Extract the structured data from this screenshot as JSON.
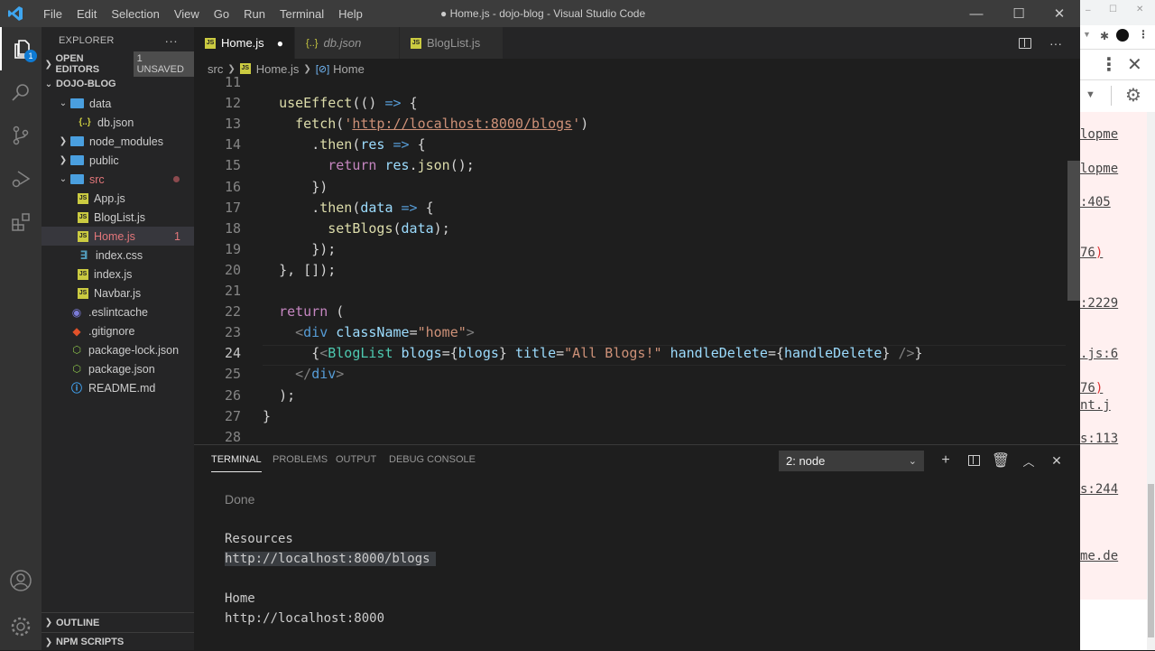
{
  "window": {
    "title": "● Home.js - dojo-blog - Visual Studio Code",
    "menu": [
      "File",
      "Edit",
      "Selection",
      "View",
      "Go",
      "Run",
      "Terminal",
      "Help"
    ],
    "controls": {
      "minimize": "—",
      "maximize": "☐",
      "close": "✕"
    }
  },
  "activity_bar": {
    "explorer_badge": "1",
    "items": [
      "explorer-icon",
      "search-icon",
      "source-control-icon",
      "run-debug-icon",
      "extensions-icon",
      "account-icon",
      "settings-gear-icon"
    ]
  },
  "sidebar": {
    "header": "EXPLORER",
    "more": "···",
    "open_editors": "OPEN EDITORS",
    "unsaved_badge": "1 UNSAVED",
    "project": "DOJO-BLOG",
    "tree": [
      {
        "label": "data",
        "type": "folder",
        "open": true,
        "depth": 1
      },
      {
        "label": "db.json",
        "type": "json",
        "depth": 2
      },
      {
        "label": "node_modules",
        "type": "folder",
        "open": false,
        "depth": 1
      },
      {
        "label": "public",
        "type": "folder",
        "open": false,
        "depth": 1
      },
      {
        "label": "src",
        "type": "folder",
        "open": true,
        "depth": 1,
        "modified": true
      },
      {
        "label": "App.js",
        "type": "js",
        "depth": 2
      },
      {
        "label": "BlogList.js",
        "type": "js",
        "depth": 2
      },
      {
        "label": "Home.js",
        "type": "js",
        "depth": 2,
        "selected": true,
        "problems": "1"
      },
      {
        "label": "index.css",
        "type": "css",
        "depth": 2
      },
      {
        "label": "index.js",
        "type": "js",
        "depth": 2
      },
      {
        "label": "Navbar.js",
        "type": "js",
        "depth": 2
      },
      {
        "label": ".eslintcache",
        "type": "cache",
        "depth": 1
      },
      {
        "label": ".gitignore",
        "type": "git",
        "depth": 1
      },
      {
        "label": "package-lock.json",
        "type": "npm",
        "depth": 1
      },
      {
        "label": "package.json",
        "type": "npm",
        "depth": 1
      },
      {
        "label": "README.md",
        "type": "info",
        "depth": 1
      }
    ],
    "outline": "OUTLINE",
    "npm_scripts": "NPM SCRIPTS"
  },
  "tabs": [
    {
      "label": "Home.js",
      "icon": "JS",
      "active": true,
      "dirty": true
    },
    {
      "label": "db.json",
      "icon": "{..}",
      "active": false,
      "italic": true
    },
    {
      "label": "BlogList.js",
      "icon": "JS",
      "active": false
    }
  ],
  "breadcrumb": [
    "src",
    "Home.js",
    "Home"
  ],
  "editor": {
    "current_line": 24,
    "lines": [
      {
        "n": 11,
        "text": ""
      },
      {
        "n": 12,
        "text": "useEffect(() => {"
      },
      {
        "n": 13,
        "text": "fetch('http://localhost:8000/blogs')"
      },
      {
        "n": 14,
        "text": ".then(res => {"
      },
      {
        "n": 15,
        "text": "return res.json();"
      },
      {
        "n": 16,
        "text": "})"
      },
      {
        "n": 17,
        "text": ".then(data => {"
      },
      {
        "n": 18,
        "text": "setBlogs(data);"
      },
      {
        "n": 19,
        "text": "});"
      },
      {
        "n": 20,
        "text": "}, []);"
      },
      {
        "n": 21,
        "text": ""
      },
      {
        "n": 22,
        "text": "return ("
      },
      {
        "n": 23,
        "text": "<div className=\"home\">"
      },
      {
        "n": 24,
        "text": "{<BlogList blogs={blogs} title=\"All Blogs!\" handleDelete={handleDelete} />}"
      },
      {
        "n": 25,
        "text": "</div>"
      },
      {
        "n": 26,
        "text": ");"
      },
      {
        "n": 27,
        "text": "}"
      },
      {
        "n": 28,
        "text": ""
      }
    ]
  },
  "panel": {
    "tabs": [
      "TERMINAL",
      "PROBLEMS",
      "OUTPUT",
      "DEBUG CONSOLE"
    ],
    "active_tab": "TERMINAL",
    "terminal_select": "2: node",
    "terminal_lines": [
      {
        "text": "Done",
        "style": "dim"
      },
      {
        "text": "Resources",
        "style": "normal"
      },
      {
        "text": "http://localhost:8000/blogs",
        "style": "selected"
      },
      {
        "text": "Home",
        "style": "normal"
      },
      {
        "text": "http://localhost:8000",
        "style": "normal"
      }
    ]
  },
  "browser_peek": {
    "links": [
      "lopme",
      "lopme",
      ":405",
      "76)",
      ":2229",
      ".js:6",
      "76)",
      "nt.j",
      "s:113",
      "s:244",
      "me.de"
    ]
  }
}
